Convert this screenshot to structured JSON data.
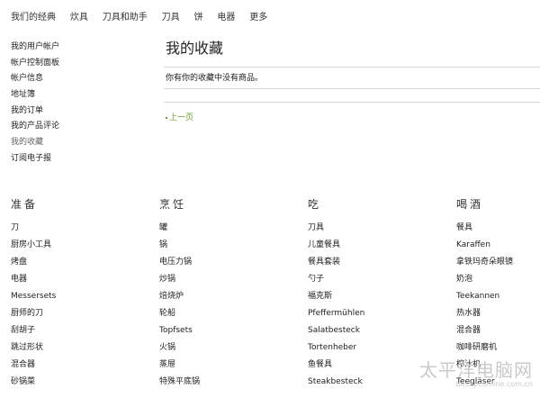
{
  "topnav": {
    "items": [
      {
        "label": "我们的经典"
      },
      {
        "label": "炊具"
      },
      {
        "label": "刀具和助手"
      },
      {
        "label": "刀具"
      },
      {
        "label": "饼"
      },
      {
        "label": "电器"
      },
      {
        "label": "更多"
      }
    ]
  },
  "sidebar": {
    "items": [
      {
        "label": "我的用户帐户"
      },
      {
        "label": "帐户控制面板"
      },
      {
        "label": "帐户信息"
      },
      {
        "label": "地址簿"
      },
      {
        "label": "我的订单"
      },
      {
        "label": "我的产品评论"
      },
      {
        "label": "我的收藏"
      },
      {
        "label": "订阅电子报"
      }
    ]
  },
  "main": {
    "title": "我的收藏",
    "empty_message": "你有你的收藏中没有商品。",
    "prev_link": "上一页",
    "link_color": "#6a9c2a"
  },
  "footer": {
    "columns": [
      {
        "title": "准备",
        "items": [
          "刀",
          "厨房小工具",
          "烤盘",
          "电器",
          "Messersets",
          "厨师的刀",
          "刮胡子",
          "跳过形状",
          "混合器",
          "砂锅菜"
        ]
      },
      {
        "title": "烹饪",
        "items": [
          "罐",
          "锅",
          "电压力锅",
          "炒锅",
          "焙烧炉",
          "轮船",
          "Topfsets",
          "火锅",
          "蒸屉",
          "特殊平底锅"
        ]
      },
      {
        "title": "吃",
        "items": [
          "刀具",
          "儿童餐具",
          "餐具套装",
          "勺子",
          "福克斯",
          "Pfeffermühlen",
          "Salatbesteck",
          "Tortenheber",
          "鱼餐具",
          "Steakbesteck"
        ]
      },
      {
        "title": "喝酒",
        "items": [
          "餐具",
          "Karaffen",
          "拿铁玛奇朵眼镜",
          "奶泡",
          "Teekannen",
          "热水器",
          "混合器",
          "咖啡研磨机",
          "榨汁机",
          "Teegläser"
        ]
      }
    ]
  },
  "watermark": {
    "main": "太平洋电脑网",
    "sub": "best.pconline.com.cn"
  }
}
